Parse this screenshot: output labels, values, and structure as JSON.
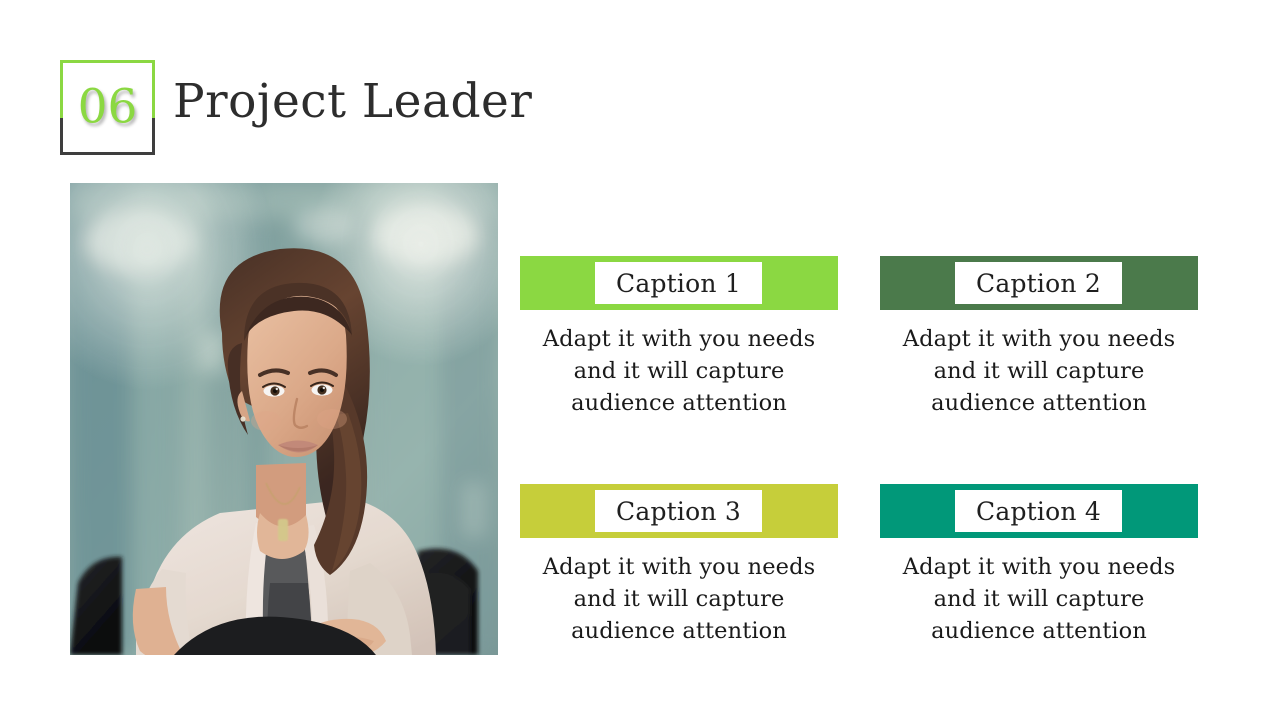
{
  "slide": {
    "number": "06",
    "title": "Project Leader",
    "background_color": "#ffffff",
    "number_color": "#8bd842",
    "title_color": "#2d2d2d"
  },
  "photo": {
    "alt": "portrait of a woman seated in a leather office chair",
    "background_description": "blurred teal green office interior"
  },
  "cards": [
    {
      "caption": "Caption 1",
      "body": "Adapt it with you needs and it will capture audience attention",
      "bar_color": "#8bd842"
    },
    {
      "caption": "Caption 2",
      "body": "Adapt it with you needs and it will capture audience attention",
      "bar_color": "#4b7a4b"
    },
    {
      "caption": "Caption 3",
      "body": "Adapt it with you needs and it will capture audience attention",
      "bar_color": "#c6ce3a"
    },
    {
      "caption": "Caption 4",
      "body": "Adapt it with you needs and it will capture audience attention",
      "bar_color": "#019879"
    }
  ]
}
